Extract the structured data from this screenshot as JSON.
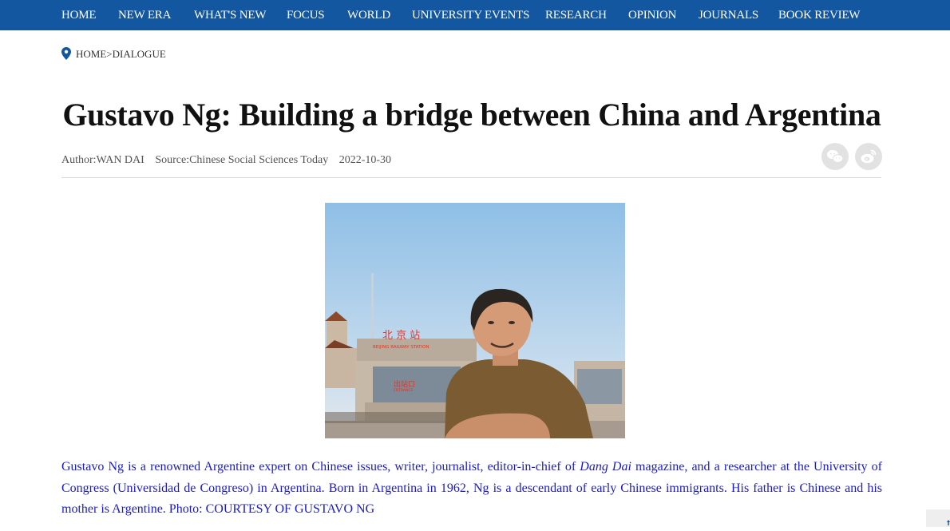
{
  "nav": {
    "items": [
      "HOME",
      "NEW ERA",
      "WHAT'S NEW",
      "FOCUS",
      "WORLD",
      "UNIVERSITY EVENTS",
      "RESEARCH",
      "OPINION",
      "JOURNALS",
      "BOOK REVIEW"
    ]
  },
  "breadcrumb": {
    "home": "HOME",
    "separator": ">",
    "current": "DIALOGUE"
  },
  "article": {
    "title": "Gustavo Ng: Building a bridge between China and Argentina",
    "author": "Author:WAN DAI",
    "source": "Source:Chinese Social Sciences Today",
    "date": "2022-10-30",
    "photo": {
      "station_sign_chars": "北 京 站",
      "station_sign_en": "BEIJING RAILWAY STATION",
      "exit_sign": "出站口",
      "exit_sign_en": "ENTRANCE"
    },
    "caption_pre": "Gustavo Ng is a renowned Argentine expert on Chinese issues, writer, journalist, editor-in-chief of ",
    "caption_em": "Dang Dai",
    "caption_post": " magazine, and a researcher at the University of Congress (Universidad de Congreso) in Argentina. Born in Argentina in 1962, Ng is a descendant of early Chinese immigrants. His father is Chinese and his mother is Argentine. Photo: COURTESY OF GUSTAVO NG"
  },
  "share": {
    "icons": [
      "wechat-icon",
      "weibo-icon"
    ]
  },
  "colors": {
    "nav_bg": "#1357a0",
    "caption_text": "#1a1acc",
    "share_bg": "#e2e2e2"
  }
}
